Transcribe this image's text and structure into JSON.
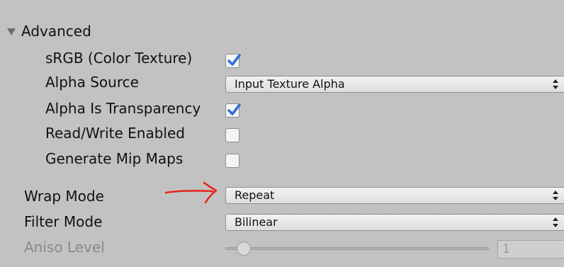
{
  "section": {
    "title": "Advanced"
  },
  "rows": {
    "srgb": {
      "label": "sRGB (Color Texture)",
      "checked": true
    },
    "alpha_source": {
      "label": "Alpha Source",
      "value": "Input Texture Alpha"
    },
    "alpha_is_transparency": {
      "label": "Alpha Is Transparency",
      "checked": true
    },
    "read_write": {
      "label": "Read/Write Enabled",
      "checked": false
    },
    "mip_maps": {
      "label": "Generate Mip Maps",
      "checked": false
    },
    "wrap_mode": {
      "label": "Wrap Mode",
      "value": "Repeat"
    },
    "filter_mode": {
      "label": "Filter Mode",
      "value": "Bilinear"
    },
    "aniso_level": {
      "label": "Aniso Level",
      "value": "1"
    }
  },
  "annotation": {
    "color": "#e8241c"
  },
  "colors": {
    "panel_bg": "#c2c2c2",
    "check_mark": "#2f6fd6"
  }
}
